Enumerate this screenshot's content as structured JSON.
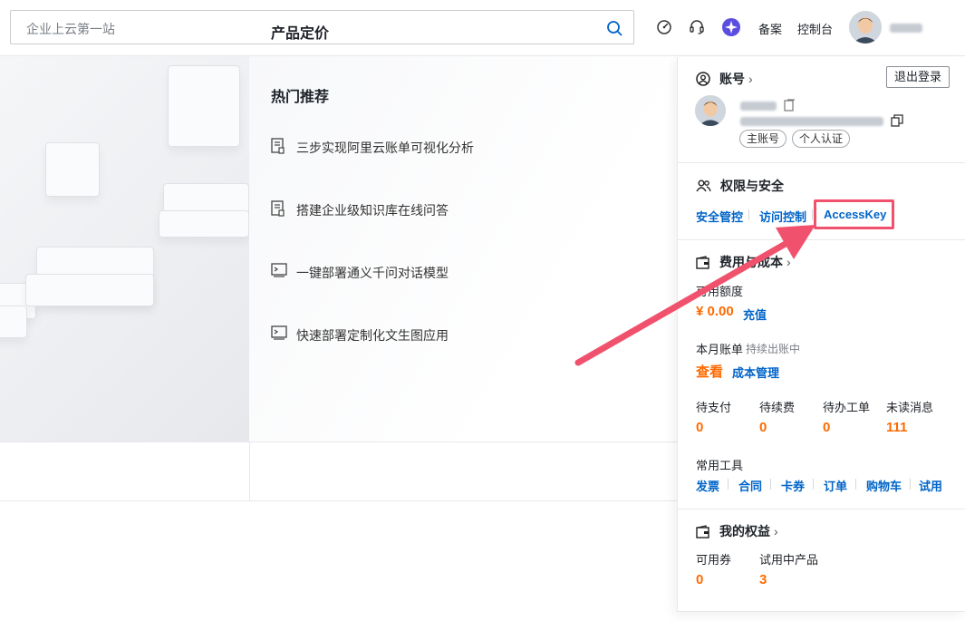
{
  "header": {
    "search_placeholder": "企业上云第一站",
    "icons": [
      "search-icon",
      "dashboard-icon",
      "support-icon",
      "ai-assistant-icon"
    ],
    "links": {
      "filing": "备案",
      "console": "控制台"
    },
    "username_blurred": true
  },
  "hot": {
    "title": "热门推荐",
    "items": [
      {
        "label": "三步实现阿里云账单可视化分析",
        "icon": "document-icon"
      },
      {
        "label": "搭建企业级知识库在线问答",
        "icon": "document-icon"
      },
      {
        "label": "一键部署通义千问对话模型",
        "icon": "terminal-icon"
      },
      {
        "label": "快速部署定制化文生图应用",
        "icon": "terminal-icon"
      }
    ]
  },
  "pricing": {
    "title": "产品定价"
  },
  "panel": {
    "account": {
      "title": "账号",
      "logout": "退出登录",
      "tags": [
        "主账号",
        "个人认证"
      ]
    },
    "security": {
      "title": "权限与安全",
      "links": [
        "安全管控",
        "访问控制",
        "AccessKey"
      ]
    },
    "billing": {
      "title": "费用与成本",
      "available_label": "可用额度",
      "balance": "¥ 0.00",
      "recharge": "充值",
      "monthly_label": "本月账单",
      "monthly_status": "持续出账中",
      "view": "查看",
      "cost_mgmt": "成本管理",
      "stats": [
        {
          "label": "待支付",
          "value": "0"
        },
        {
          "label": "待续费",
          "value": "0"
        },
        {
          "label": "待办工单",
          "value": "0"
        },
        {
          "label": "未读消息",
          "value": "111"
        }
      ],
      "tools_label": "常用工具",
      "tools": [
        "发票",
        "合同",
        "卡券",
        "订单",
        "购物车",
        "试用"
      ]
    },
    "benefits": {
      "title": "我的权益",
      "stats": [
        {
          "label": "可用券",
          "value": "0"
        },
        {
          "label": "试用中产品",
          "value": "3"
        }
      ]
    }
  },
  "colors": {
    "accent": "#0064c8",
    "orange": "#ff6a00",
    "highlight": "#f0516d"
  }
}
